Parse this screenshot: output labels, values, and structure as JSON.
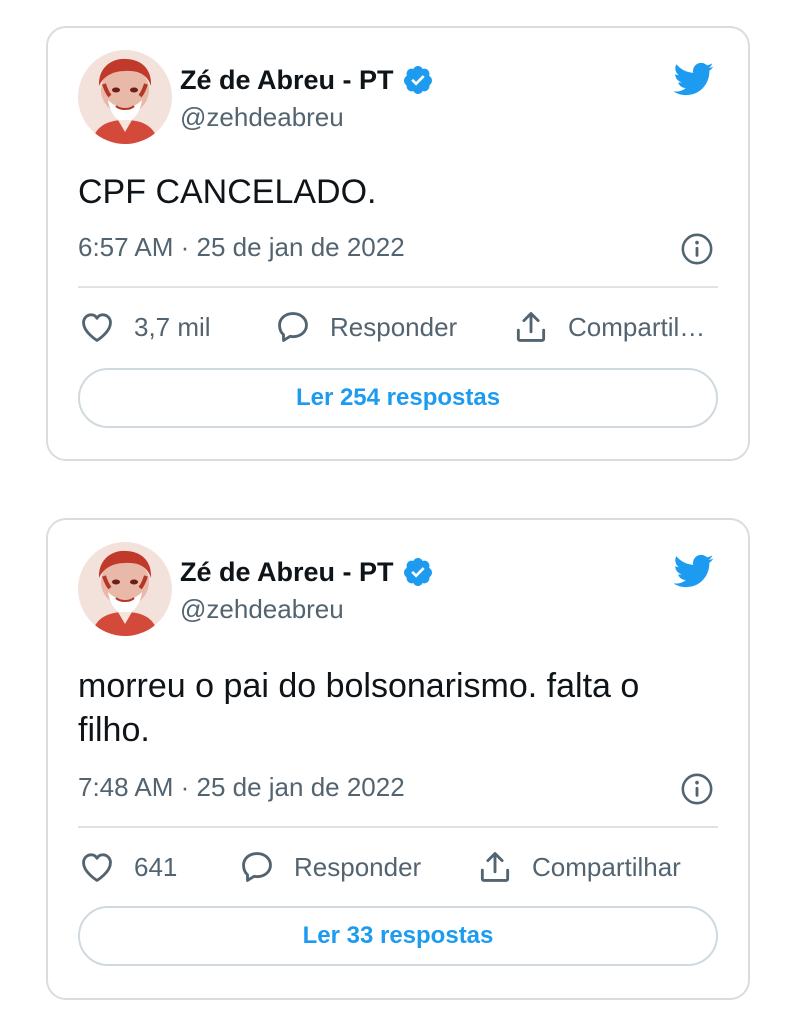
{
  "colors": {
    "twitter_blue": "#1d9bf0",
    "text_primary": "#0f1419",
    "text_secondary": "#536471",
    "border": "#d9dde1"
  },
  "tweets": [
    {
      "author_name": "Zé de Abreu - PT",
      "handle": "@zehdeabreu",
      "text": "CPF CANCELADO.",
      "timestamp": "6:57 AM · 25 de jan de 2022",
      "likes": "3,7 mil",
      "reply_label": "Responder",
      "share_label": "Compartil…",
      "replies_button": "Ler 254 respostas",
      "icons": [
        "verified-badge-icon",
        "twitter-bird-icon",
        "info-icon",
        "heart-icon",
        "comment-icon",
        "share-icon"
      ]
    },
    {
      "author_name": "Zé de Abreu - PT",
      "handle": "@zehdeabreu",
      "text": "morreu o pai do bolsonarismo. falta o filho.",
      "timestamp": "7:48 AM · 25 de jan de 2022",
      "likes": "641",
      "reply_label": "Responder",
      "share_label": "Compartilhar",
      "replies_button": "Ler 33 respostas",
      "icons": [
        "verified-badge-icon",
        "twitter-bird-icon",
        "info-icon",
        "heart-icon",
        "comment-icon",
        "share-icon"
      ]
    }
  ]
}
